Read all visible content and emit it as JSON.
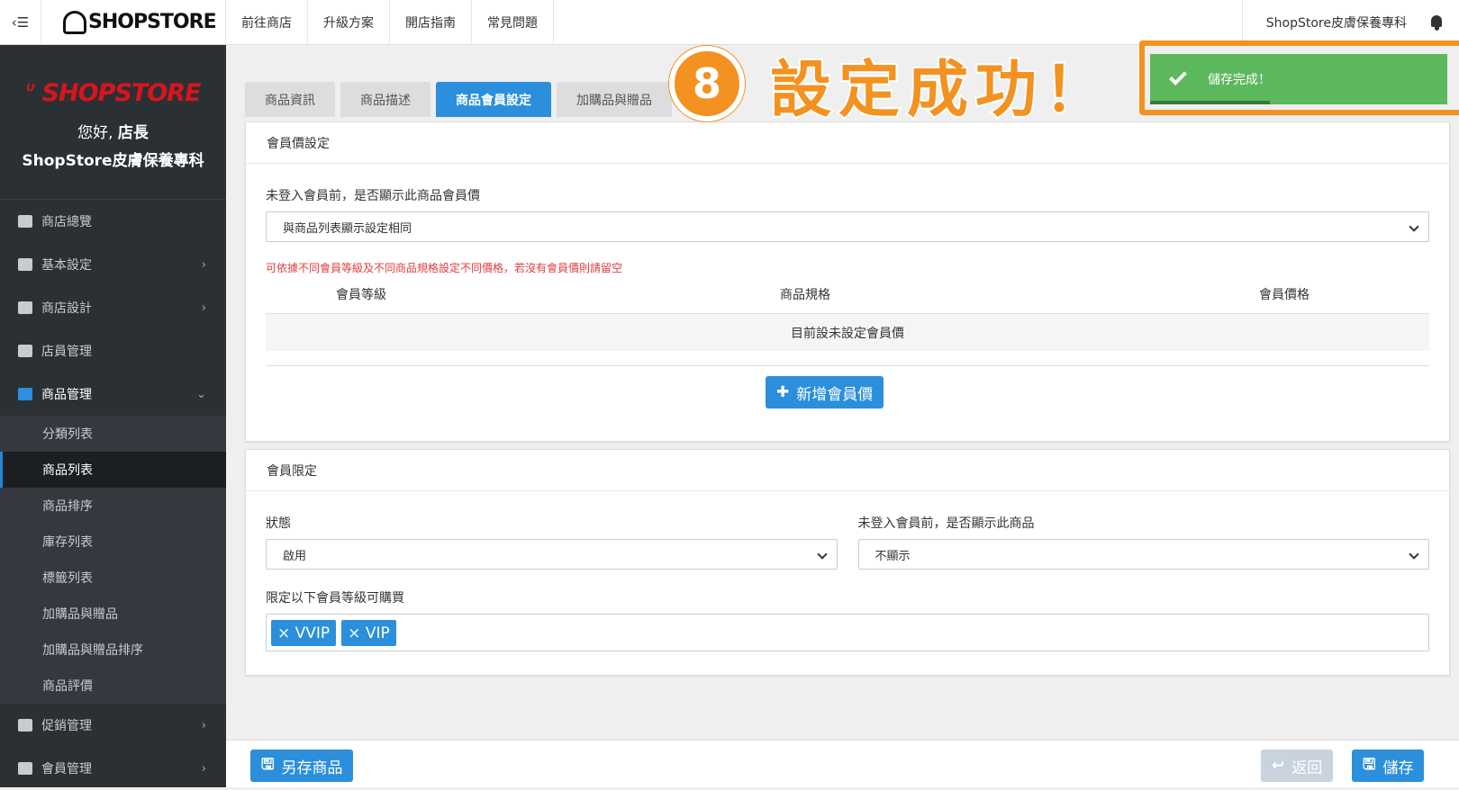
{
  "topbar": {
    "toggle_icon": "‹☰",
    "logo_text": "SHOPSTORE",
    "nav": [
      "前往商店",
      "升級方案",
      "開店指南",
      "常見問題"
    ],
    "shop_name": "ShopStore皮膚保養專科"
  },
  "sidebar": {
    "logo_text": "SHOPSTORE",
    "greeting": "您好,",
    "role": "店長",
    "shop_name": "ShopStore皮膚保養專科",
    "items": [
      {
        "label": "商店總覽",
        "icon": "dashboard-icon"
      },
      {
        "label": "基本設定",
        "icon": "bank-icon"
      },
      {
        "label": "商店設計",
        "icon": "magic-wand-icon"
      },
      {
        "label": "店員管理",
        "icon": "lock-icon"
      },
      {
        "label": "商品管理",
        "icon": "cart-icon"
      },
      {
        "label": "促銷管理",
        "icon": "gift-icon"
      },
      {
        "label": "會員管理",
        "icon": "users-icon"
      }
    ],
    "sub_items": [
      "分類列表",
      "商品列表",
      "商品排序",
      "庫存列表",
      "標籤列表",
      "加購品與贈品",
      "加購品與贈品排序",
      "商品評價"
    ]
  },
  "tabs": [
    "商品資訊",
    "商品描述",
    "商品會員設定",
    "加購品與贈品"
  ],
  "member_price": {
    "title": "會員價設定",
    "guest_label": "未登入會員前，是否顯示此商品會員價",
    "guest_value": "與商品列表顯示設定相同",
    "hint": "可依據不同會員等級及不同商品規格設定不同價格，若沒有會員價則請留空",
    "columns": [
      "會員等級",
      "商品規格",
      "會員價格"
    ],
    "empty_text": "目前設未設定會員價",
    "add_button": "新增會員價"
  },
  "member_limit": {
    "title": "會員限定",
    "status_label": "狀態",
    "status_value": "啟用",
    "guest_label": "未登入會員前，是否顯示此商品",
    "guest_value": "不顯示",
    "levels_label": "限定以下會員等級可購買",
    "tags": [
      "× VVIP",
      "× VIP"
    ]
  },
  "footer": {
    "save_as": "另存商品",
    "back": "返回",
    "save": "儲存"
  },
  "toast": {
    "message": "儲存完成！"
  },
  "callout": {
    "number": "8",
    "text": "設定成功！"
  },
  "colors": {
    "accent": "#2b8fdc",
    "success": "#5cb85c",
    "highlight": "#f39220",
    "brand_red": "#d9151b",
    "sidebar": "#2b3035"
  }
}
